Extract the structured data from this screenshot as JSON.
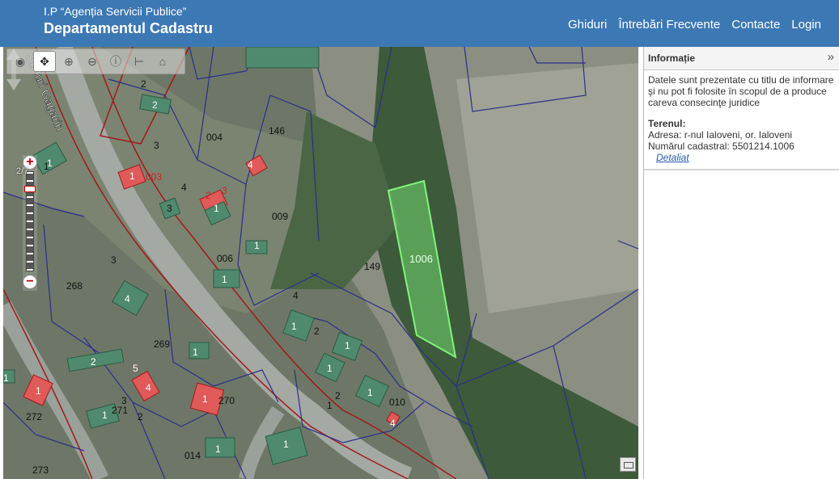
{
  "header": {
    "org": "I.P “Agenția Servicii Publice”",
    "title": "Departamentul Cadastru",
    "nav": [
      "Ghiduri",
      "Întrebări Frecvente",
      "Contacte",
      "Login"
    ]
  },
  "colors": {
    "header_bg": "#3c78b4",
    "parcel_border": "#2a2f8a",
    "red_boundary": "#a11a1a",
    "selected_parcel": "#7ff57a",
    "building": "#4f8a6e",
    "building_highlight": "#e05a5a"
  },
  "map": {
    "street_label": "str. Iuri Gagarin",
    "zoom_level": "2/7",
    "toolbar": [
      "globe-icon",
      "pan-icon",
      "zoom-in-icon",
      "zoom-out-icon",
      "info-icon",
      "measure-icon",
      "home-icon"
    ],
    "selected_parcel_label": "1006",
    "parcel_labels": [
      "004",
      "146",
      "003",
      "009",
      "006",
      "268",
      "149",
      "269",
      "270",
      "010",
      "272",
      "271",
      "014",
      "273",
      "2",
      "3",
      "1",
      "4",
      "5"
    ],
    "building_labels": [
      "2",
      "1",
      "3",
      "1",
      "1",
      "4",
      "2",
      "3",
      "4",
      "3",
      "1",
      "1",
      "1",
      "1",
      "2",
      "1",
      "1",
      "4",
      "1",
      "2",
      "1",
      "1",
      "4",
      "2",
      "3",
      "5",
      "4",
      "1",
      "1",
      "2",
      "1",
      "1",
      "1"
    ]
  },
  "info": {
    "title": "Informație",
    "notice": "Datele sunt prezentate cu titlu de informare şi nu pot fi folosite în scopul de a produce careva consecinţe juridice",
    "section_title": "Terenul:",
    "address": "Adresa: r-nul Ialoveni, or. Ialoveni",
    "cadastral": "Numărul cadastral: 5501214.1006",
    "link": "Detaliat"
  }
}
